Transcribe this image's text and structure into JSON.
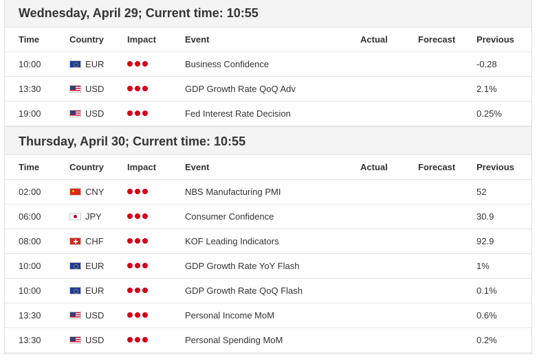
{
  "columns": {
    "time": "Time",
    "country": "Country",
    "impact": "Impact",
    "event": "Event",
    "actual": "Actual",
    "forecast": "Forecast",
    "previous": "Previous"
  },
  "colors": {
    "impact_high": "#d0021b",
    "header_bg": "#f4f4f4"
  },
  "impact_levels": {
    "high": 3
  },
  "days": [
    {
      "title": "Wednesday, April 29; Current time: 10:55",
      "events": [
        {
          "time": "10:00",
          "country": "EUR",
          "flag": "eu-flag-icon",
          "impact": "high",
          "event": "Business Confidence",
          "actual": "",
          "forecast": "",
          "previous": "-0.28"
        },
        {
          "time": "13:30",
          "country": "USD",
          "flag": "us-flag-icon",
          "impact": "high",
          "event": "GDP Growth Rate QoQ Adv",
          "actual": "",
          "forecast": "",
          "previous": "2.1%"
        },
        {
          "time": "19:00",
          "country": "USD",
          "flag": "us-flag-icon",
          "impact": "high",
          "event": "Fed Interest Rate Decision",
          "actual": "",
          "forecast": "",
          "previous": "0.25%"
        }
      ]
    },
    {
      "title": "Thursday, April 30; Current time: 10:55",
      "events": [
        {
          "time": "02:00",
          "country": "CNY",
          "flag": "cn-flag-icon",
          "impact": "high",
          "event": "NBS Manufacturing PMI",
          "actual": "",
          "forecast": "",
          "previous": "52"
        },
        {
          "time": "06:00",
          "country": "JPY",
          "flag": "jp-flag-icon",
          "impact": "high",
          "event": "Consumer Confidence",
          "actual": "",
          "forecast": "",
          "previous": "30.9"
        },
        {
          "time": "08:00",
          "country": "CHF",
          "flag": "ch-flag-icon",
          "impact": "high",
          "event": "KOF Leading Indicators",
          "actual": "",
          "forecast": "",
          "previous": "92.9"
        },
        {
          "time": "10:00",
          "country": "EUR",
          "flag": "eu-flag-icon",
          "impact": "high",
          "event": "GDP Growth Rate YoY Flash",
          "actual": "",
          "forecast": "",
          "previous": "1%"
        },
        {
          "time": "10:00",
          "country": "EUR",
          "flag": "eu-flag-icon",
          "impact": "high",
          "event": "GDP Growth Rate QoQ Flash",
          "actual": "",
          "forecast": "",
          "previous": "0.1%"
        },
        {
          "time": "13:30",
          "country": "USD",
          "flag": "us-flag-icon",
          "impact": "high",
          "event": "Personal Income MoM",
          "actual": "",
          "forecast": "",
          "previous": "0.6%"
        },
        {
          "time": "13:30",
          "country": "USD",
          "flag": "us-flag-icon",
          "impact": "high",
          "event": "Personal Spending MoM",
          "actual": "",
          "forecast": "",
          "previous": "0.2%"
        }
      ]
    }
  ]
}
